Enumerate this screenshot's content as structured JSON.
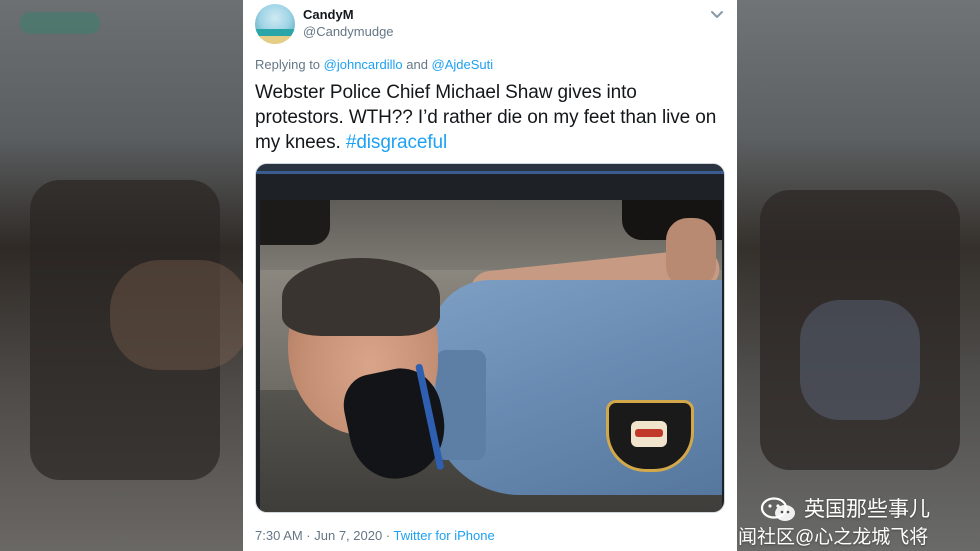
{
  "tweet": {
    "display_name": "CandyM",
    "handle": "@Candymudge",
    "reply_prefix": "Replying to ",
    "reply_to_1": "@johncardillo",
    "reply_and": " and ",
    "reply_to_2": "@AjdeSuti",
    "text_body": "Webster Police Chief Michael Shaw gives into protestors. WTH?? I’d rather die on my feet than live on my knees. ",
    "hashtag": "#disgraceful",
    "timestamp": "7:30 AM · Jun 7, 2020 · ",
    "source": "Twitter for iPhone",
    "icons": {
      "avatar": "beach-avatar",
      "menu": "chevron-down-icon"
    }
  },
  "watermark": {
    "title": "英国那些事儿",
    "subtitle": "闻社区@心之龙城飞将",
    "icon": "wechat-logo-icon"
  },
  "colors": {
    "link": "#1da1f2",
    "text": "#14171a",
    "muted": "#657786"
  }
}
